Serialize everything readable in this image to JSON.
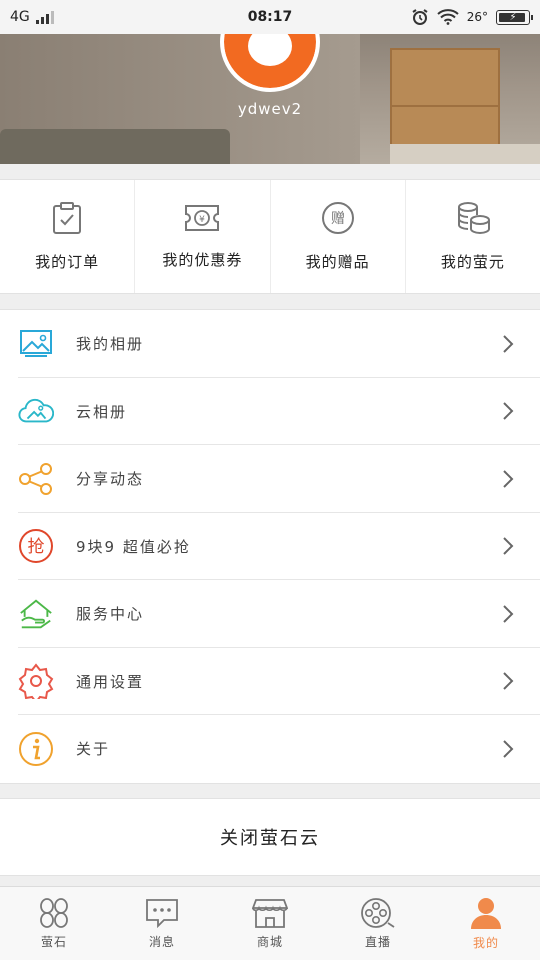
{
  "status_bar": {
    "network": "4G",
    "time": "08:17",
    "temperature": "26",
    "battery_percent": 0.85
  },
  "profile": {
    "username": "ydwev2"
  },
  "quick_actions": [
    {
      "label": "我的订单",
      "icon": "clipboard-check-icon"
    },
    {
      "label": "我的优惠券",
      "icon": "coupon-icon"
    },
    {
      "label": "我的赠品",
      "icon": "gift-icon"
    },
    {
      "label": "我的萤元",
      "icon": "coins-icon"
    }
  ],
  "menu": [
    {
      "label": "我的相册",
      "icon": "photo-album-icon",
      "color": "#29a8d8"
    },
    {
      "label": "云相册",
      "icon": "cloud-photo-icon",
      "color": "#2ab7c9"
    },
    {
      "label": "分享动态",
      "icon": "share-icon",
      "color": "#f0a22e"
    },
    {
      "label": "9块9 超值必抢",
      "icon": "grab-deal-icon",
      "color": "#e0472b"
    },
    {
      "label": "服务中心",
      "icon": "service-center-icon",
      "color": "#4cb848"
    },
    {
      "label": "通用设置",
      "icon": "settings-gear-icon",
      "color": "#e8584a"
    },
    {
      "label": "关于",
      "icon": "info-icon",
      "color": "#f0a22e"
    }
  ],
  "close_button": {
    "label": "关闭萤石云"
  },
  "tab_bar": [
    {
      "label": "萤石",
      "icon": "ezviz-home-icon",
      "active": false
    },
    {
      "label": "消息",
      "icon": "message-icon",
      "active": false
    },
    {
      "label": "商城",
      "icon": "store-icon",
      "active": false
    },
    {
      "label": "直播",
      "icon": "film-reel-icon",
      "active": false
    },
    {
      "label": "我的",
      "icon": "profile-icon",
      "active": true
    }
  ],
  "colors": {
    "accent": "#f08a4b",
    "icon_gray": "#777777"
  }
}
